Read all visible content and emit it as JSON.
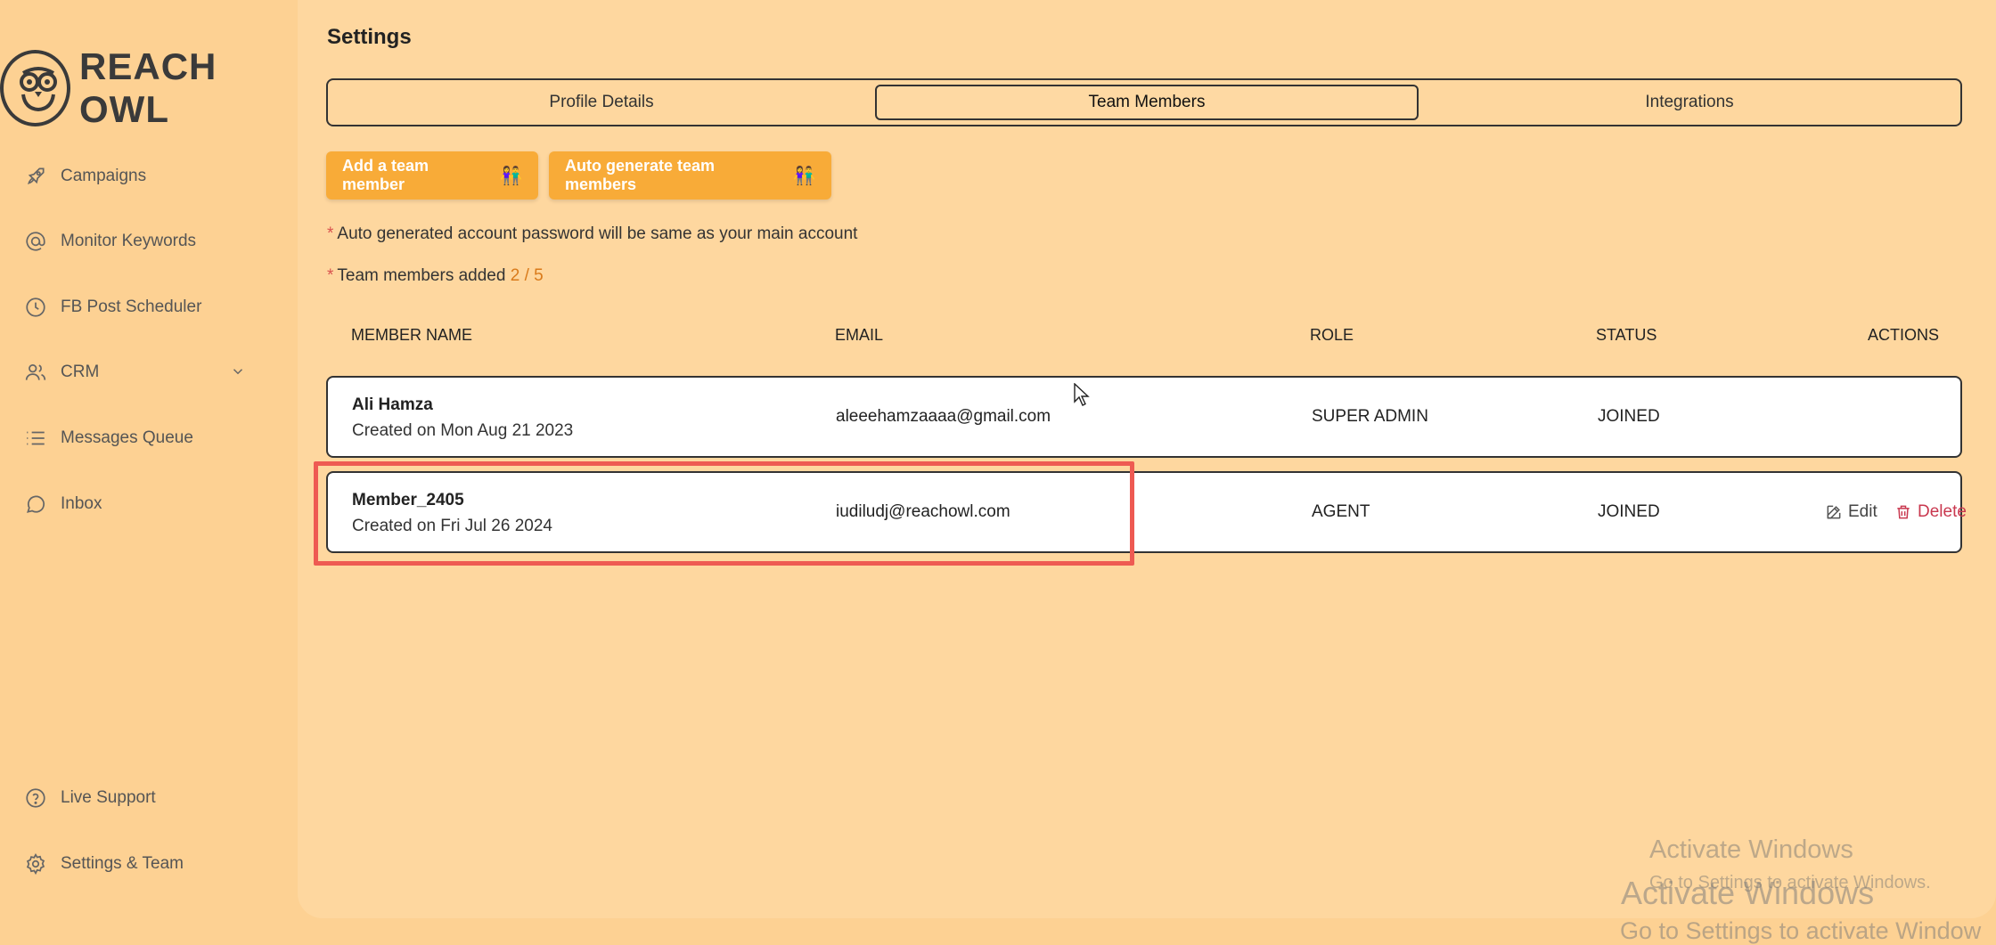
{
  "brand": {
    "name": "REACH OWL"
  },
  "sidebar": {
    "items": [
      {
        "label": "Campaigns",
        "icon": "rocket-icon"
      },
      {
        "label": "Monitor Keywords",
        "icon": "at-icon"
      },
      {
        "label": "FB Post Scheduler",
        "icon": "clock-icon"
      },
      {
        "label": "CRM",
        "icon": "users-icon",
        "expandable": true
      },
      {
        "label": "Messages Queue",
        "icon": "list-icon"
      },
      {
        "label": "Inbox",
        "icon": "chat-icon"
      }
    ],
    "bottom": [
      {
        "label": "Live Support",
        "icon": "help-icon"
      },
      {
        "label": "Settings & Team",
        "icon": "gear-icon"
      }
    ]
  },
  "page": {
    "title": "Settings"
  },
  "tabs": [
    {
      "label": "Profile Details",
      "active": false
    },
    {
      "label": "Team Members",
      "active": true
    },
    {
      "label": "Integrations",
      "active": false
    }
  ],
  "actions": {
    "add_member": "Add a team member",
    "auto_generate": "Auto generate team members",
    "emoji": "👫"
  },
  "notes": {
    "password": "Auto generated account password will be same as your main account",
    "members_added_label": "Team members added",
    "members_added_count": "2 / 5"
  },
  "table": {
    "headers": [
      "MEMBER NAME",
      "EMAIL",
      "ROLE",
      "STATUS",
      "ACTIONS"
    ],
    "rows": [
      {
        "name": "Ali Hamza",
        "created": "Created on Mon Aug 21 2023",
        "email": "aleeehamzaaaa@gmail.com",
        "role": "SUPER ADMIN",
        "status": "JOINED"
      },
      {
        "name": "Member_2405",
        "created": "Created on Fri Jul 26 2024",
        "email": "iudiludj@reachowl.com",
        "role": "AGENT",
        "status": "JOINED",
        "edit": "Edit",
        "delete": "Delete"
      }
    ]
  },
  "watermark": {
    "line1": "Activate Windows",
    "line2": "Go to Settings to activate Windows.",
    "line3": "Activate Windows",
    "line4": "Go to Settings to activate Window"
  },
  "colors": {
    "accent": "#f8ab38",
    "highlight": "#ee5a52",
    "delete": "#c9384f",
    "count": "#d97a1a"
  }
}
